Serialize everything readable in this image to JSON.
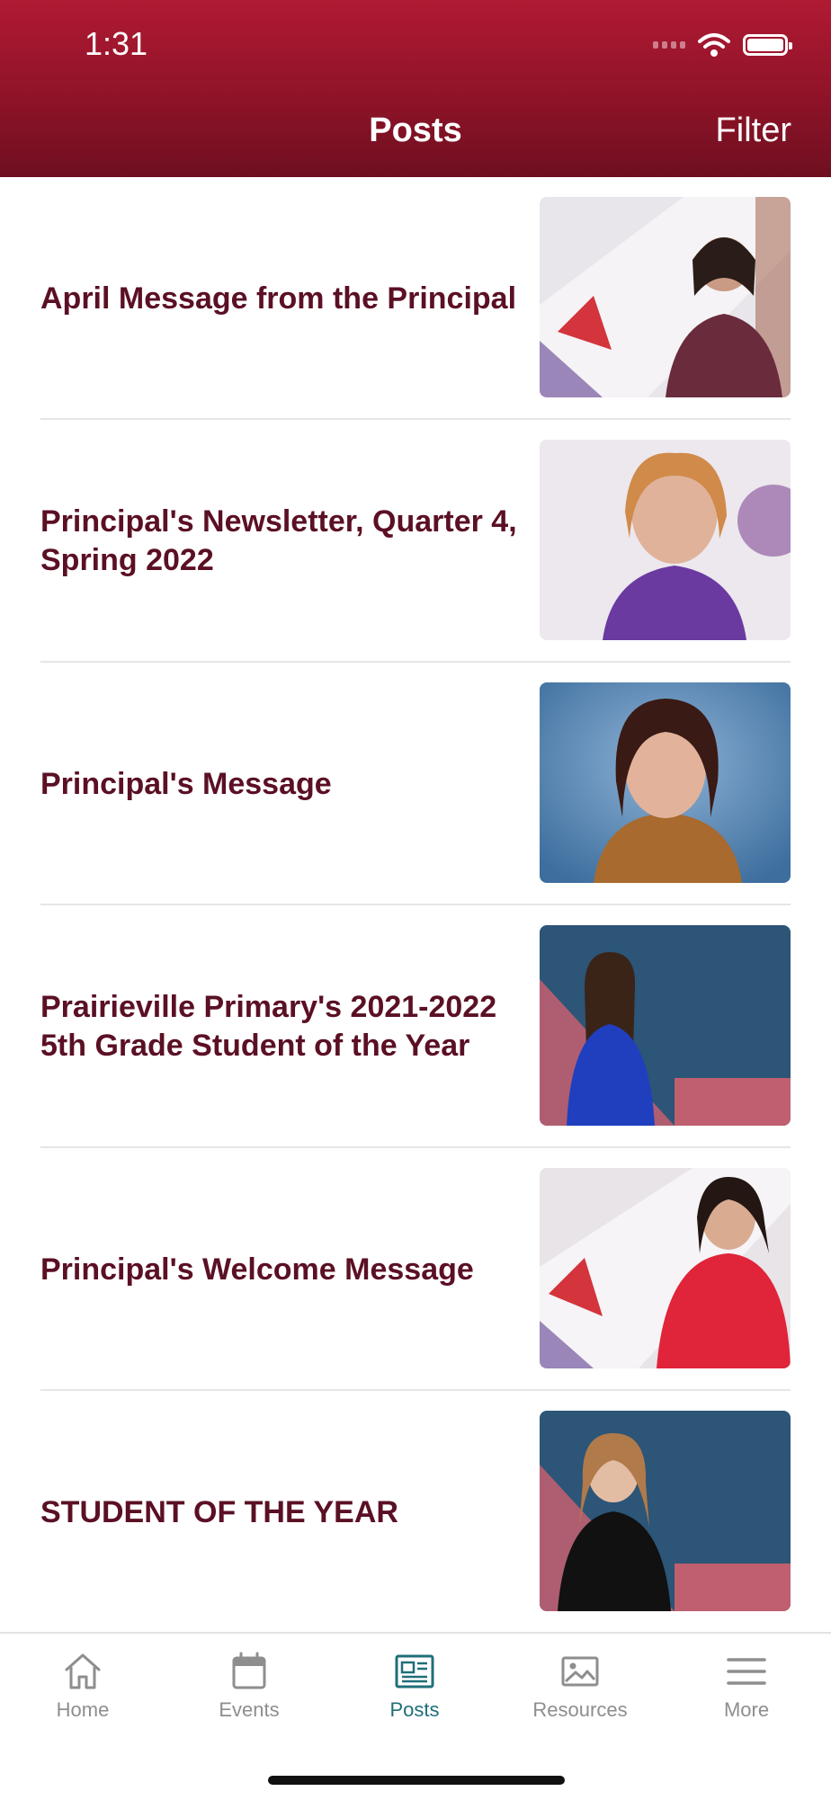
{
  "status": {
    "time": "1:31"
  },
  "header": {
    "title": "Posts",
    "filter_label": "Filter"
  },
  "posts": [
    {
      "title": "April Message from the Principal"
    },
    {
      "title": "Principal's Newsletter, Quarter 4, Spring 2022"
    },
    {
      "title": "Principal's Message"
    },
    {
      "title": "Prairieville Primary's 2021-2022 5th Grade Student of the Year"
    },
    {
      "title": "Principal's Welcome Message"
    },
    {
      "title": "STUDENT OF THE YEAR"
    }
  ],
  "tabs": [
    {
      "label": "Home",
      "icon": "home-icon"
    },
    {
      "label": "Events",
      "icon": "calendar-icon"
    },
    {
      "label": "Posts",
      "icon": "newspaper-icon",
      "active": true
    },
    {
      "label": "Resources",
      "icon": "image-icon"
    },
    {
      "label": "More",
      "icon": "menu-icon"
    }
  ],
  "colors": {
    "header": "#9b1630",
    "post_title": "#5b1024",
    "active_tab": "#1f6f78",
    "inactive_tab": "#8e8e8e"
  }
}
